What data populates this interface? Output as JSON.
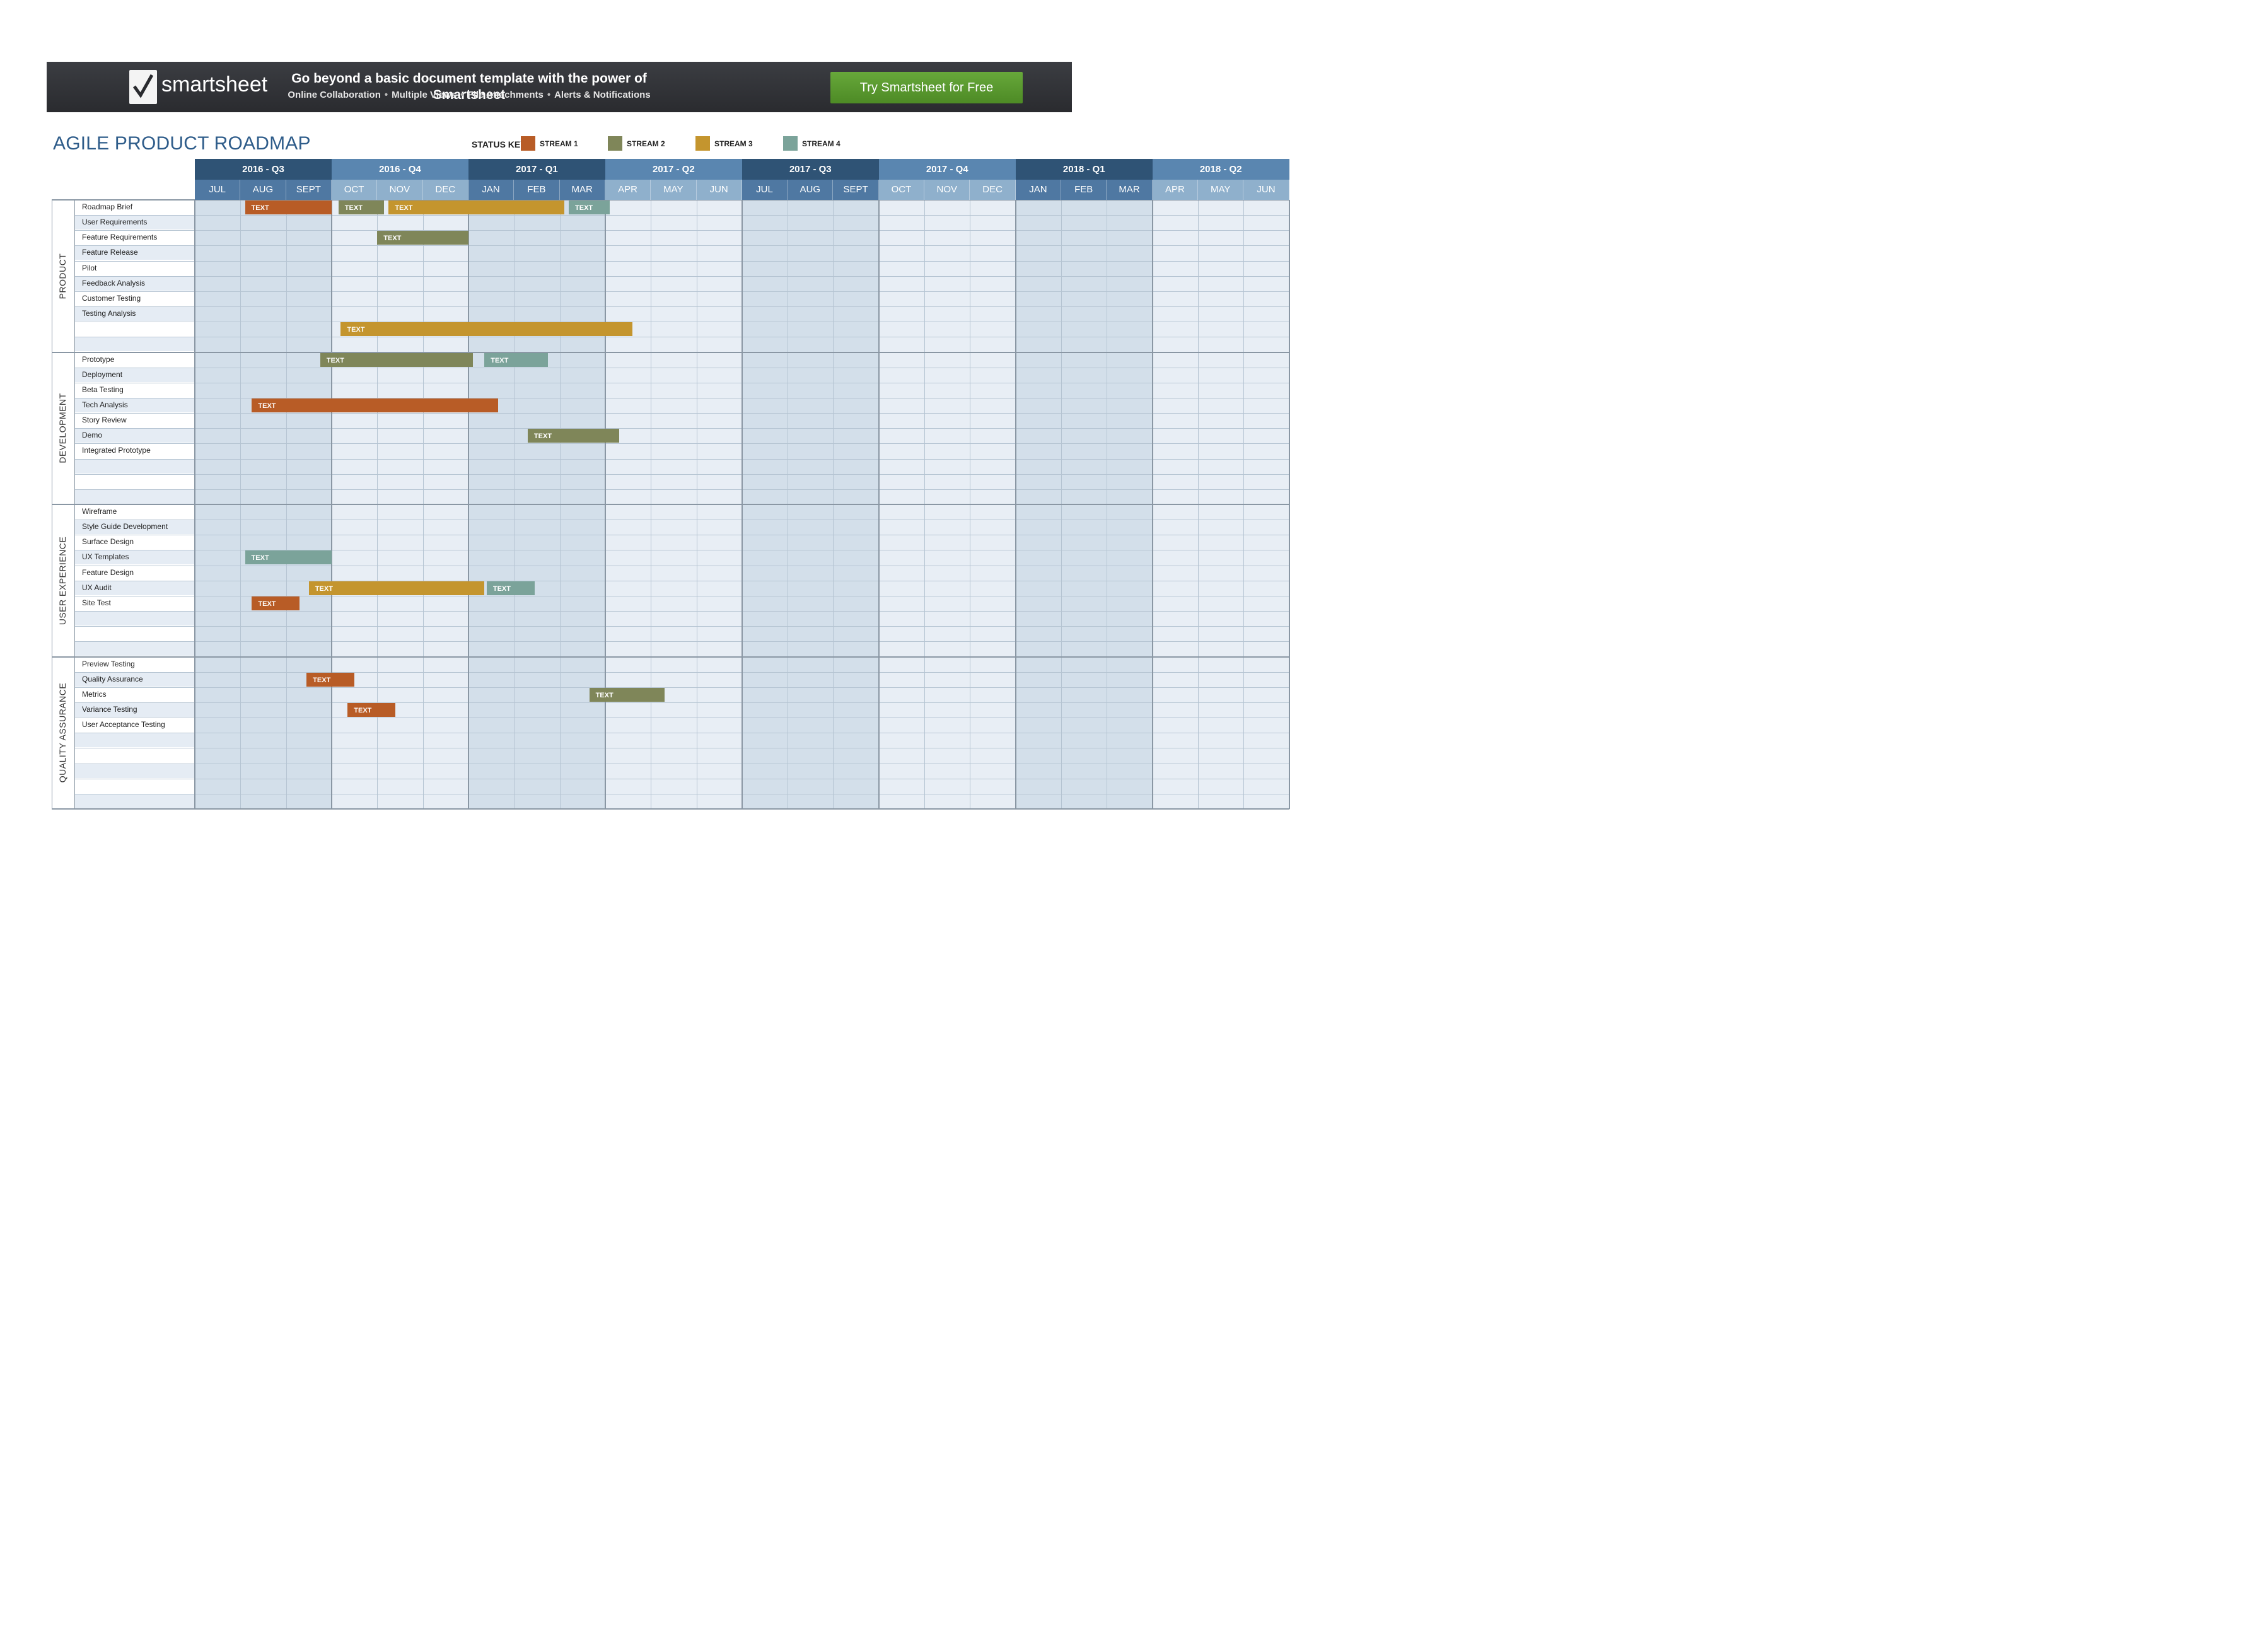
{
  "banner": {
    "logo_text": "smartsheet",
    "headline": "Go beyond a basic document template with the power of Smartsheet",
    "features": [
      "Online Collaboration",
      "Multiple Views",
      "File Attachments",
      "Alerts & Notifications"
    ],
    "cta_label": "Try Smartsheet for Free"
  },
  "page_title": "AGILE PRODUCT ROADMAP",
  "status_key": {
    "label": "STATUS KEY",
    "streams": [
      {
        "label": "STREAM 1",
        "color": "#b85c26"
      },
      {
        "label": "STREAM 2",
        "color": "#7f8659"
      },
      {
        "label": "STREAM 3",
        "color": "#c4952e"
      },
      {
        "label": "STREAM 4",
        "color": "#7ba39a"
      }
    ]
  },
  "colors": {
    "quarter_dark": "#2f5375",
    "quarter_light": "#5a86b0",
    "month_dark": "#4f78a2",
    "month_light": "#8fb0cc",
    "shade_dark": "#d3dfea",
    "shade_light": "#e8eef5",
    "row_alt": "#e5ecf4"
  },
  "quarters": [
    "2016 - Q3",
    "2016 - Q4",
    "2017 - Q1",
    "2017 - Q2",
    "2017 - Q3",
    "2017 - Q4",
    "2018 - Q1",
    "2018 - Q2"
  ],
  "months": [
    "JUL",
    "AUG",
    "SEPT",
    "OCT",
    "NOV",
    "DEC",
    "JAN",
    "FEB",
    "MAR",
    "APR",
    "MAY",
    "JUN",
    "JUL",
    "AUG",
    "SEPT",
    "OCT",
    "NOV",
    "DEC",
    "JAN",
    "FEB",
    "MAR",
    "APR",
    "MAY",
    "JUN"
  ],
  "sections": [
    {
      "name": "PRODUCT",
      "tasks": [
        "Roadmap Brief",
        "User Requirements",
        "Feature Requirements",
        "Feature Release",
        "Pilot",
        "Feedback Analysis",
        "Customer Testing",
        "Testing Analysis",
        "",
        ""
      ]
    },
    {
      "name": "DEVELOPMENT",
      "tasks": [
        "Prototype",
        "Deployment",
        "Beta Testing",
        "Tech Analysis",
        "Story Review",
        "Demo",
        "Integrated Prototype",
        "",
        "",
        ""
      ]
    },
    {
      "name": "USER EXPERIENCE",
      "tasks": [
        "Wireframe",
        "Style Guide Development",
        "Surface Design",
        "UX Templates",
        "Feature Design",
        "UX Audit",
        "Site Test",
        "",
        "",
        ""
      ]
    },
    {
      "name": "QUALITY ASSURANCE",
      "tasks": [
        "Preview Testing",
        "Quality Assurance",
        "Metrics",
        "Variance Testing",
        "User Acceptance Testing",
        "",
        "",
        "",
        "",
        ""
      ]
    }
  ],
  "bar_label": "TEXT",
  "bars": [
    {
      "section": 0,
      "row": 0,
      "start": 1.1,
      "end": 3.0,
      "stream": 0
    },
    {
      "section": 0,
      "row": 0,
      "start": 3.15,
      "end": 4.15,
      "stream": 1
    },
    {
      "section": 0,
      "row": 0,
      "start": 4.25,
      "end": 8.1,
      "stream": 2
    },
    {
      "section": 0,
      "row": 0,
      "start": 8.2,
      "end": 9.1,
      "stream": 3
    },
    {
      "section": 0,
      "row": 2,
      "start": 4.0,
      "end": 6.0,
      "stream": 1
    },
    {
      "section": 0,
      "row": 8,
      "start": 3.2,
      "end": 9.6,
      "stream": 2
    },
    {
      "section": 1,
      "row": 0,
      "start": 2.75,
      "end": 6.1,
      "stream": 1
    },
    {
      "section": 1,
      "row": 0,
      "start": 6.35,
      "end": 7.75,
      "stream": 3
    },
    {
      "section": 1,
      "row": 3,
      "start": 1.25,
      "end": 6.65,
      "stream": 0
    },
    {
      "section": 1,
      "row": 5,
      "start": 7.3,
      "end": 9.3,
      "stream": 1
    },
    {
      "section": 2,
      "row": 3,
      "start": 1.1,
      "end": 3.0,
      "stream": 3
    },
    {
      "section": 2,
      "row": 5,
      "start": 2.5,
      "end": 6.35,
      "stream": 2
    },
    {
      "section": 2,
      "row": 5,
      "start": 6.4,
      "end": 7.45,
      "stream": 3
    },
    {
      "section": 2,
      "row": 6,
      "start": 1.25,
      "end": 2.3,
      "stream": 0
    },
    {
      "section": 3,
      "row": 1,
      "start": 2.45,
      "end": 3.5,
      "stream": 0
    },
    {
      "section": 3,
      "row": 2,
      "start": 8.65,
      "end": 10.3,
      "stream": 1
    },
    {
      "section": 3,
      "row": 3,
      "start": 3.35,
      "end": 4.4,
      "stream": 0
    }
  ]
}
